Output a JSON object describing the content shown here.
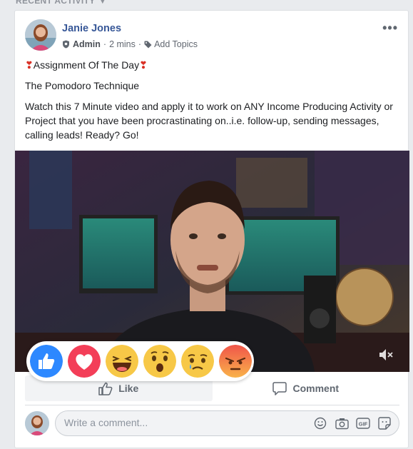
{
  "section": {
    "label": "RECENT ACTIVITY"
  },
  "post": {
    "author": "Janie Jones",
    "role": "Admin",
    "time": "2 mins",
    "add_topics": "Add Topics",
    "title_text": "Assignment Of The Day",
    "subtitle": "The Pomodoro Technique",
    "body": "Watch this 7 Minute video and apply it to work on ANY Income Producing Activity or Project that you have been procrastinating on..i.e. follow-up, sending messages, calling leads! Ready? Go!"
  },
  "actions": {
    "like": "Like",
    "comment": "Comment"
  },
  "comment": {
    "placeholder": "Write a comment..."
  },
  "reactions": [
    "like",
    "love",
    "haha",
    "wow",
    "sad",
    "angry"
  ],
  "colors": {
    "link": "#385898",
    "like_blue": "#1877f2",
    "love_red": "#f33e58",
    "heart_red": "#d93025"
  }
}
